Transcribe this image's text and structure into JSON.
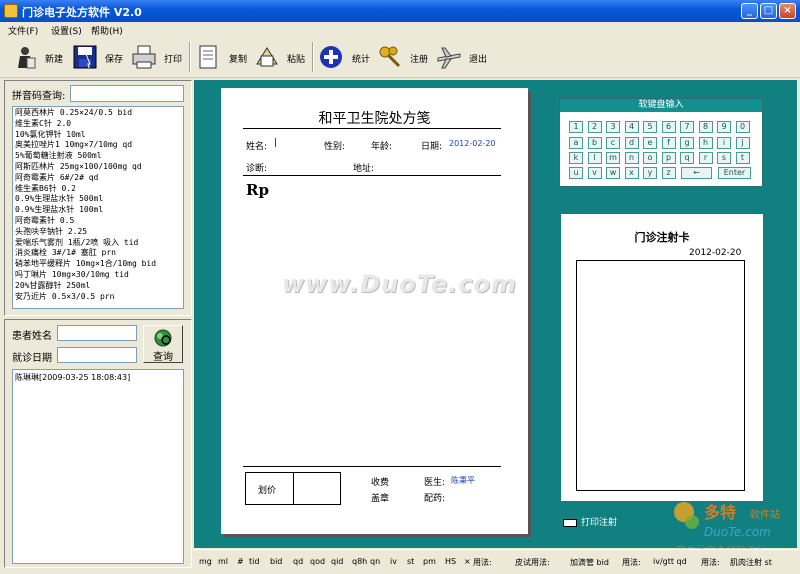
{
  "window": {
    "title": "门诊电子处方软件 V2.0"
  },
  "menu": [
    "文件(F)",
    "设置(S)",
    "帮助(H)"
  ],
  "toolbar": {
    "new_label": "新建",
    "save_label": "保存",
    "print_label": "打印",
    "copy_label": "复制",
    "paste_label": "粘贴",
    "stats_label": "统计",
    "register_label": "注册",
    "exit_label": "退出"
  },
  "left": {
    "pinyin_label": "拼音码查询:",
    "drugs": [
      "阿莫西林片 0.25×24/0.5 bid",
      "维生素C针 2.0",
      "10%氯化钾针 10ml",
      "奥美拉唑片1 10mg×7/10mg qd",
      "5%葡萄糖注射液 500ml",
      "阿斯匹林片 25mg×100/100mg qd",
      "阿奇霉素片 6#/2# qd",
      "维生素B6针 0.2",
      "0.9%生理盐水针 500ml",
      "0.9%生理盐水针 100ml",
      "阿奇霉素针 0.5",
      "头孢呋辛钠针 2.25",
      "爱喘乐气雾剂 1瓶/2喷 吸入 tid",
      "消炎痛栓 3#/1# 塞肛 prn",
      "硝苯地平缓释片 10mg×1合/10mg bid",
      "吗丁啉片 10mg×30/10mg tid",
      "20%甘露醇针 250ml",
      "安乃近片 0.5×3/0.5 prn"
    ],
    "patient_name_label": "患者姓名",
    "visit_date_label": "就诊日期",
    "query_label": "查询",
    "history": [
      "陈琳琳[2009-03-25 18:08:43]"
    ]
  },
  "prescription": {
    "title": "和平卫生院处方笺",
    "name_label": "姓名:",
    "name_value": "|",
    "gender_label": "性别:",
    "age_label": "年龄:",
    "date_label": "日期:",
    "date_value": "2012-02-20",
    "diagnosis_label": "诊断:",
    "address_label": "地址:",
    "rp": "Rp",
    "fee_label": "划价",
    "charge_label": "收费",
    "stamp_label": "盖章",
    "doctor_label": "医生:",
    "doctor_value": "陈秉平",
    "dispense_label": "配药:"
  },
  "keyboard": {
    "title": "软键盘输入",
    "row1": [
      "1",
      "2",
      "3",
      "4",
      "5",
      "6",
      "7",
      "8",
      "9",
      "0"
    ],
    "row2": [
      "a",
      "b",
      "c",
      "d",
      "e",
      "f",
      "g",
      "h",
      "i",
      "j"
    ],
    "row3": [
      "k",
      "l",
      "m",
      "n",
      "o",
      "p",
      "q",
      "r",
      "s",
      "t"
    ],
    "row4": [
      "u",
      "v",
      "w",
      "x",
      "y",
      "z"
    ],
    "backspace": "←",
    "enter": "Enter"
  },
  "injection_card": {
    "title": "门诊注射卡",
    "date": "2012-02-20",
    "print_label": "打印注射"
  },
  "statusbar": {
    "abbreviations": [
      "mg",
      "ml",
      "#",
      "tid",
      "bid",
      "qd",
      "qod",
      "qid",
      "q8h",
      "qn",
      "iv",
      "st",
      "pm",
      "HS",
      "×"
    ],
    "usage_label": "用法:",
    "skin_test": "皮试用法:",
    "drip": "加滴管 bid",
    "usage2_label": "用法:",
    "ivgtt": "iv/gtt qd",
    "usage3_label": "用法:",
    "im": "肌肉注射 st"
  },
  "watermark": {
    "site": "www.DuoTe.com",
    "logo_cn": "多特",
    "logo_sub": "软件站",
    "logo_en": "DuoTe.com",
    "logo_tag": "国内最安全的软件站"
  },
  "colors": {
    "titlebar": "#0A58D9",
    "main_bg": "#108080",
    "face": "#ECE9D8"
  }
}
